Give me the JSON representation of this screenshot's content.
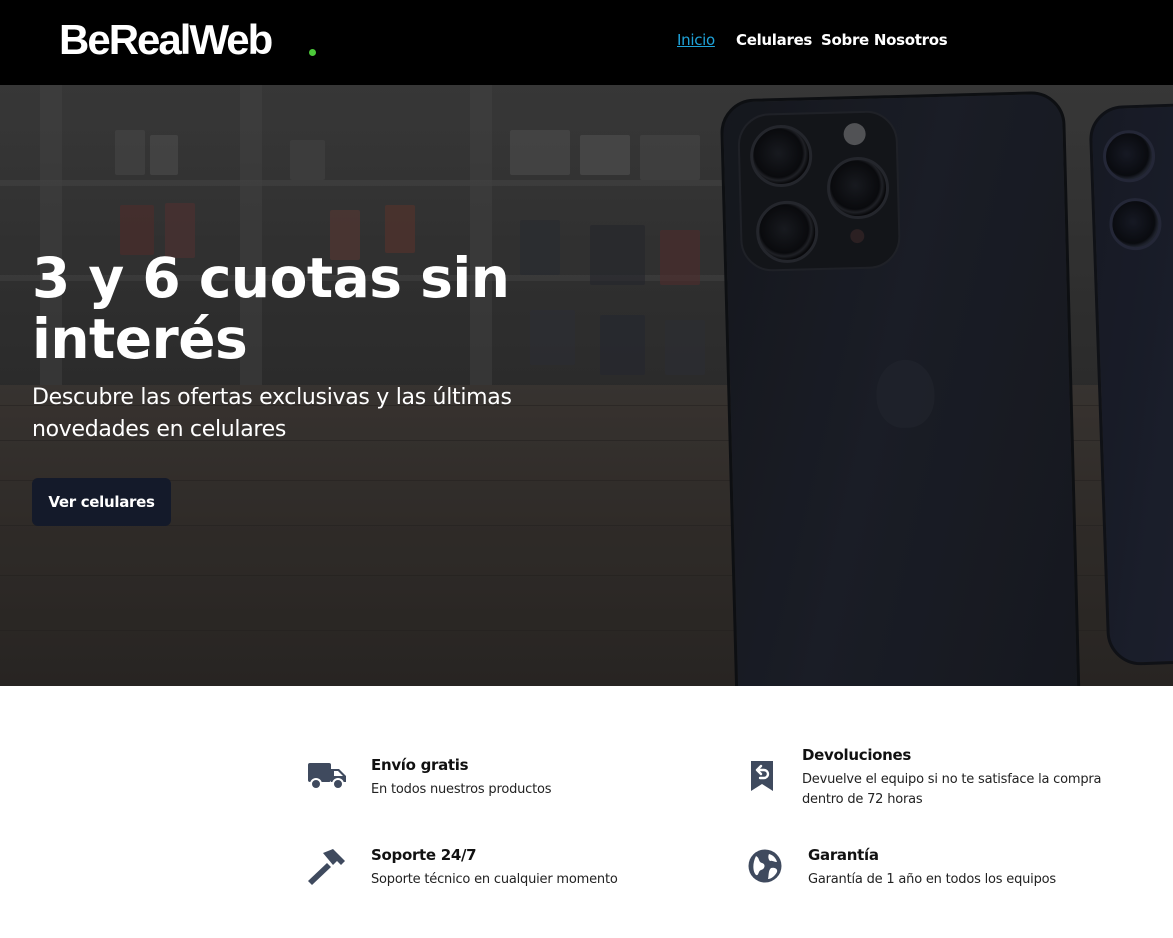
{
  "brand": {
    "logo_text": "BeRealWeb",
    "dot_color": "#4cc93a"
  },
  "nav": {
    "items": [
      {
        "label": "Inicio",
        "active": true
      },
      {
        "label": "Celulares",
        "active": false
      },
      {
        "label": "Sobre Nosotros",
        "active": false
      }
    ],
    "active_color": "#1fa3d9"
  },
  "hero": {
    "title": "3 y 6 cuotas sin interés",
    "subtitle": "Descubre las ofertas exclusivas y las últimas novedades en celulares",
    "cta_label": "Ver celulares",
    "cta_color": "#141a2a"
  },
  "features": [
    {
      "icon": "truck-icon",
      "title": "Envío gratis",
      "description": "En todos nuestros productos"
    },
    {
      "icon": "return-icon",
      "title": "Devoluciones",
      "description": "Devuelve el equipo si no te satisface la compra dentro de 72 horas"
    },
    {
      "icon": "hammer-icon",
      "title": "Soporte 24/7",
      "description": "Soporte técnico en cualquier momento"
    },
    {
      "icon": "globe-icon",
      "title": "Garantía",
      "description": "Garantía de 1 año en todos los equipos"
    }
  ],
  "icon_color": "#3f4a5e"
}
